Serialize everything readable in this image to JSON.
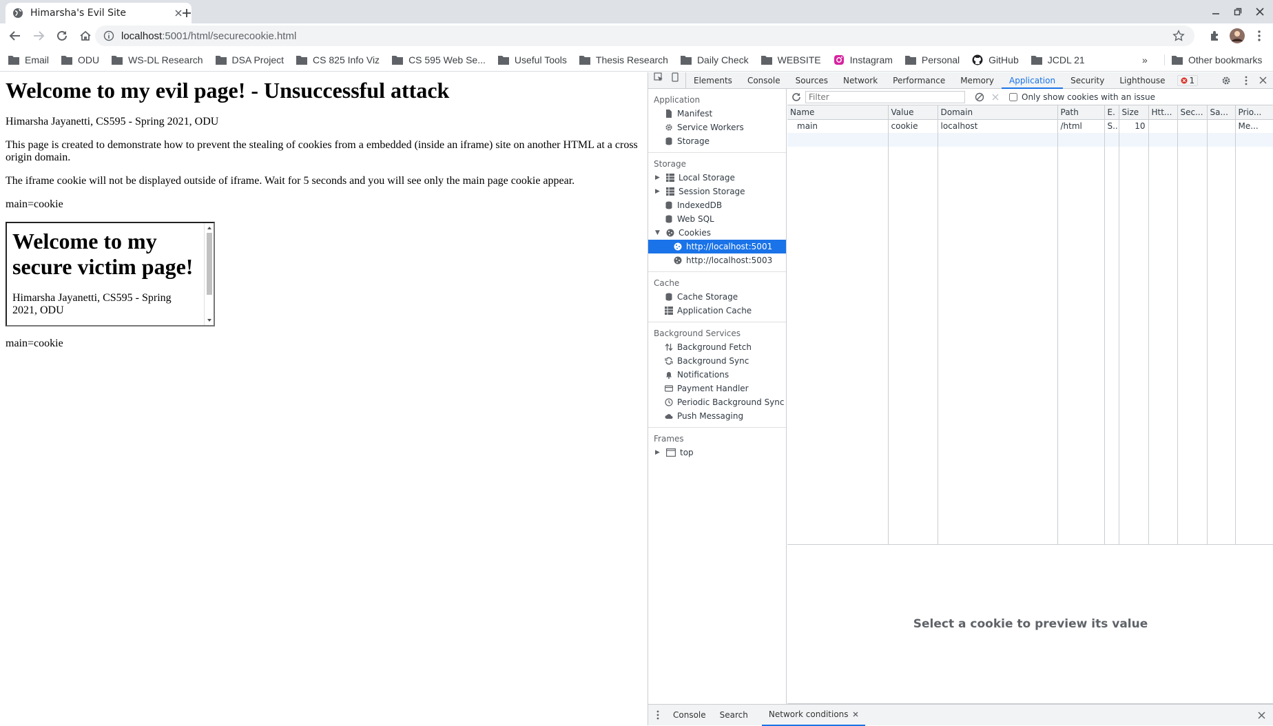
{
  "browser": {
    "tab_title": "Himarsha's Evil Site",
    "url_host": "localhost",
    "url_rest": ":5001/html/securecookie.html",
    "bookmarks": [
      "Email",
      "ODU",
      "WS-DL Research",
      "DSA Project",
      "CS 825 Info Viz",
      "CS 595 Web Se...",
      "Useful Tools",
      "Thesis Research",
      "Daily Check",
      "WEBSITE",
      "Instagram",
      "Personal",
      "GitHub",
      "JCDL 21"
    ],
    "overflow": "»",
    "other_bookmarks": "Other bookmarks"
  },
  "page": {
    "title": "Welcome to my evil page! - Unsuccessful attack",
    "author": "Himarsha Jayanetti, CS595 - Spring 2021, ODU",
    "description": "This page is created to demonstrate how to prevent the stealing of cookies from a embedded (inside an iframe) site on another HTML at a cross origin domain.",
    "note": "The iframe cookie will not be displayed outside of iframe. Wait for 5 seconds and you will see only the main page cookie appear.",
    "cookie_line_1": "main=cookie",
    "iframe_title": "Welcome to my secure victim page!",
    "iframe_author": "Himarsha Jayanetti, CS595 - Spring 2021, ODU",
    "cookie_line_2": "main=cookie"
  },
  "devtools": {
    "tabs": [
      "Elements",
      "Console",
      "Sources",
      "Network",
      "Performance",
      "Memory",
      "Application",
      "Security",
      "Lighthouse"
    ],
    "active_tab": "Application",
    "error_count": "1",
    "sidebar": {
      "application_header": "Application",
      "application_items": [
        "Manifest",
        "Service Workers",
        "Storage"
      ],
      "storage_header": "Storage",
      "storage_items": [
        "Local Storage",
        "Session Storage",
        "IndexedDB",
        "Web SQL",
        "Cookies"
      ],
      "cookie_origins": [
        "http://localhost:5001",
        "http://localhost:5003"
      ],
      "cache_header": "Cache",
      "cache_items": [
        "Cache Storage",
        "Application Cache"
      ],
      "bg_header": "Background Services",
      "bg_items": [
        "Background Fetch",
        "Background Sync",
        "Notifications",
        "Payment Handler",
        "Periodic Background Sync",
        "Push Messaging"
      ],
      "frames_header": "Frames",
      "frames_items": [
        "top"
      ]
    },
    "cookies": {
      "filter_placeholder": "Filter",
      "only_issues_label": "Only show cookies with an issue",
      "columns": [
        "Name",
        "Value",
        "Domain",
        "Path",
        "E.",
        "Size",
        "Htt...",
        "Sec...",
        "Sa...",
        "Prio..."
      ],
      "rows": [
        [
          "main",
          "cookie",
          "localhost",
          "/html",
          "S...",
          "10",
          "",
          "",
          "",
          "Me..."
        ]
      ],
      "preview_text": "Select a cookie to preview its value"
    },
    "drawer_tabs": [
      "Console",
      "Search",
      "Network conditions"
    ]
  }
}
